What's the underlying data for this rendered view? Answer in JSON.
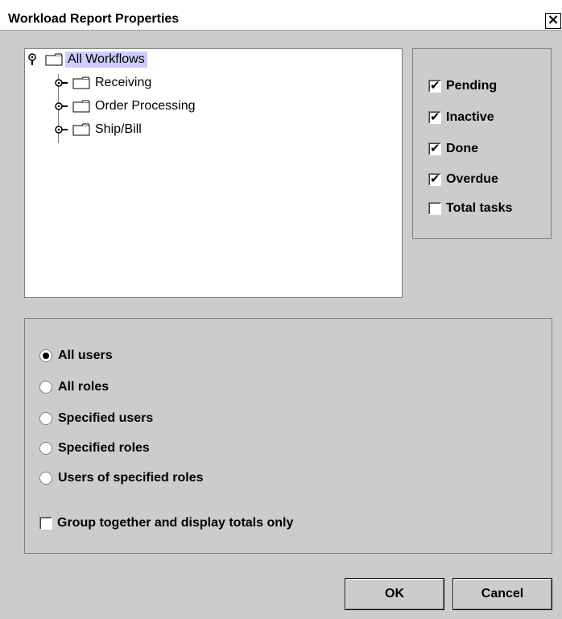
{
  "window": {
    "title": "Workload Report Properties",
    "close_glyph": "×"
  },
  "tree": {
    "root": {
      "label": "All Workflows",
      "icon": "folder-icon",
      "expanded": true,
      "selected": true
    },
    "children": [
      {
        "label": "Receiving",
        "icon": "folder-icon",
        "expanded": false
      },
      {
        "label": "Order Processing",
        "icon": "folder-icon",
        "expanded": false
      },
      {
        "label": "Ship/Bill",
        "icon": "folder-icon",
        "expanded": false
      }
    ]
  },
  "status_options": [
    {
      "label": "Pending",
      "checked": true
    },
    {
      "label": "Inactive",
      "checked": true
    },
    {
      "label": "Done",
      "checked": true
    },
    {
      "label": "Overdue",
      "checked": true
    },
    {
      "label": "Total tasks",
      "checked": false
    }
  ],
  "user_selection": {
    "options": [
      {
        "label": "All users",
        "selected": true
      },
      {
        "label": "All roles",
        "selected": false
      },
      {
        "label": "Specified users",
        "selected": false
      },
      {
        "label": "Specified roles",
        "selected": false
      },
      {
        "label": "Users of specified roles",
        "selected": false
      }
    ],
    "group_checkbox": {
      "label": "Group together and display totals only",
      "checked": false
    }
  },
  "buttons": {
    "ok": "OK",
    "cancel": "Cancel"
  },
  "colors": {
    "selection_highlight": "#ccccff",
    "dialog_background": "#cccccc"
  }
}
